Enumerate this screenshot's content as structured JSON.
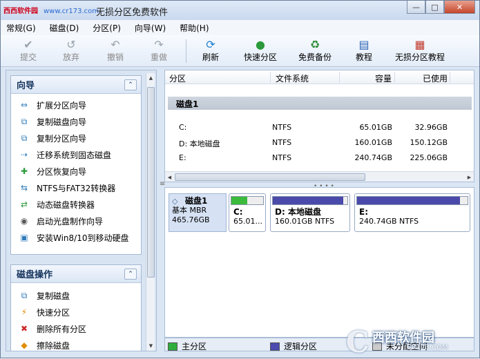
{
  "window": {
    "title": "无损分区免费软件",
    "watermark_site": "西西软件园",
    "watermark_url": "www.cr173.com",
    "controls": {
      "minimize": "—",
      "maximize": "□",
      "close": "✕"
    }
  },
  "menu": [
    "常规(G)",
    "磁盘(D)",
    "分区(P)",
    "向导(W)",
    "帮助(H)"
  ],
  "toolbar": {
    "commit": "提交",
    "discard": "放弃",
    "undo": "撤销",
    "redo": "重做",
    "refresh": "刷新",
    "quick_partition": "快速分区",
    "free_backup": "免费备份",
    "tutorial": "教程",
    "lossless_tutorial": "无损分区教程"
  },
  "wizard_panel": {
    "title": "向导",
    "items": [
      "扩展分区向导",
      "复制磁盘向导",
      "复制分区向导",
      "迁移系统到固态磁盘",
      "分区恢复向导",
      "NTFS与FAT32转换器",
      "动态磁盘转换器",
      "启动光盘制作向导",
      "安装Win8/10到移动硬盘"
    ]
  },
  "disk_ops_panel": {
    "title": "磁盘操作",
    "items": [
      "复制磁盘",
      "快速分区",
      "删除所有分区",
      "擦除磁盘"
    ]
  },
  "partition_list": {
    "columns": [
      "分区",
      "文件系统",
      "容量",
      "已使用"
    ],
    "group": "磁盘1",
    "rows": [
      {
        "partition": "C:",
        "fs": "NTFS",
        "capacity": "65.01GB",
        "used": "32.96GB"
      },
      {
        "partition": "D: 本地磁盘",
        "fs": "NTFS",
        "capacity": "160.01GB",
        "used": "150.12GB"
      },
      {
        "partition": "E:",
        "fs": "NTFS",
        "capacity": "240.74GB",
        "used": "225.06GB"
      }
    ]
  },
  "disk_map": {
    "disk": {
      "name": "磁盘1",
      "type": "基本 MBR",
      "size": "465.76GB"
    },
    "partitions": [
      {
        "name": "C:",
        "detail": "65.01...",
        "fill": 0.51,
        "color": "#3cba3c"
      },
      {
        "name": "D: 本地磁盘",
        "detail": "160.01GB NTFS",
        "fill": 0.94,
        "color": "#4a4aaa"
      },
      {
        "name": "E:",
        "detail": "240.74GB NTFS",
        "fill": 0.93,
        "color": "#4a4aaa"
      }
    ]
  },
  "legend": {
    "primary": "主分区",
    "primary_color": "#2fae3d",
    "logical": "逻辑分区",
    "logical_color": "#4b4bb0",
    "unallocated": "未分配空间"
  },
  "logo": {
    "text": "西西软件园",
    "url": "CR173.COM"
  }
}
